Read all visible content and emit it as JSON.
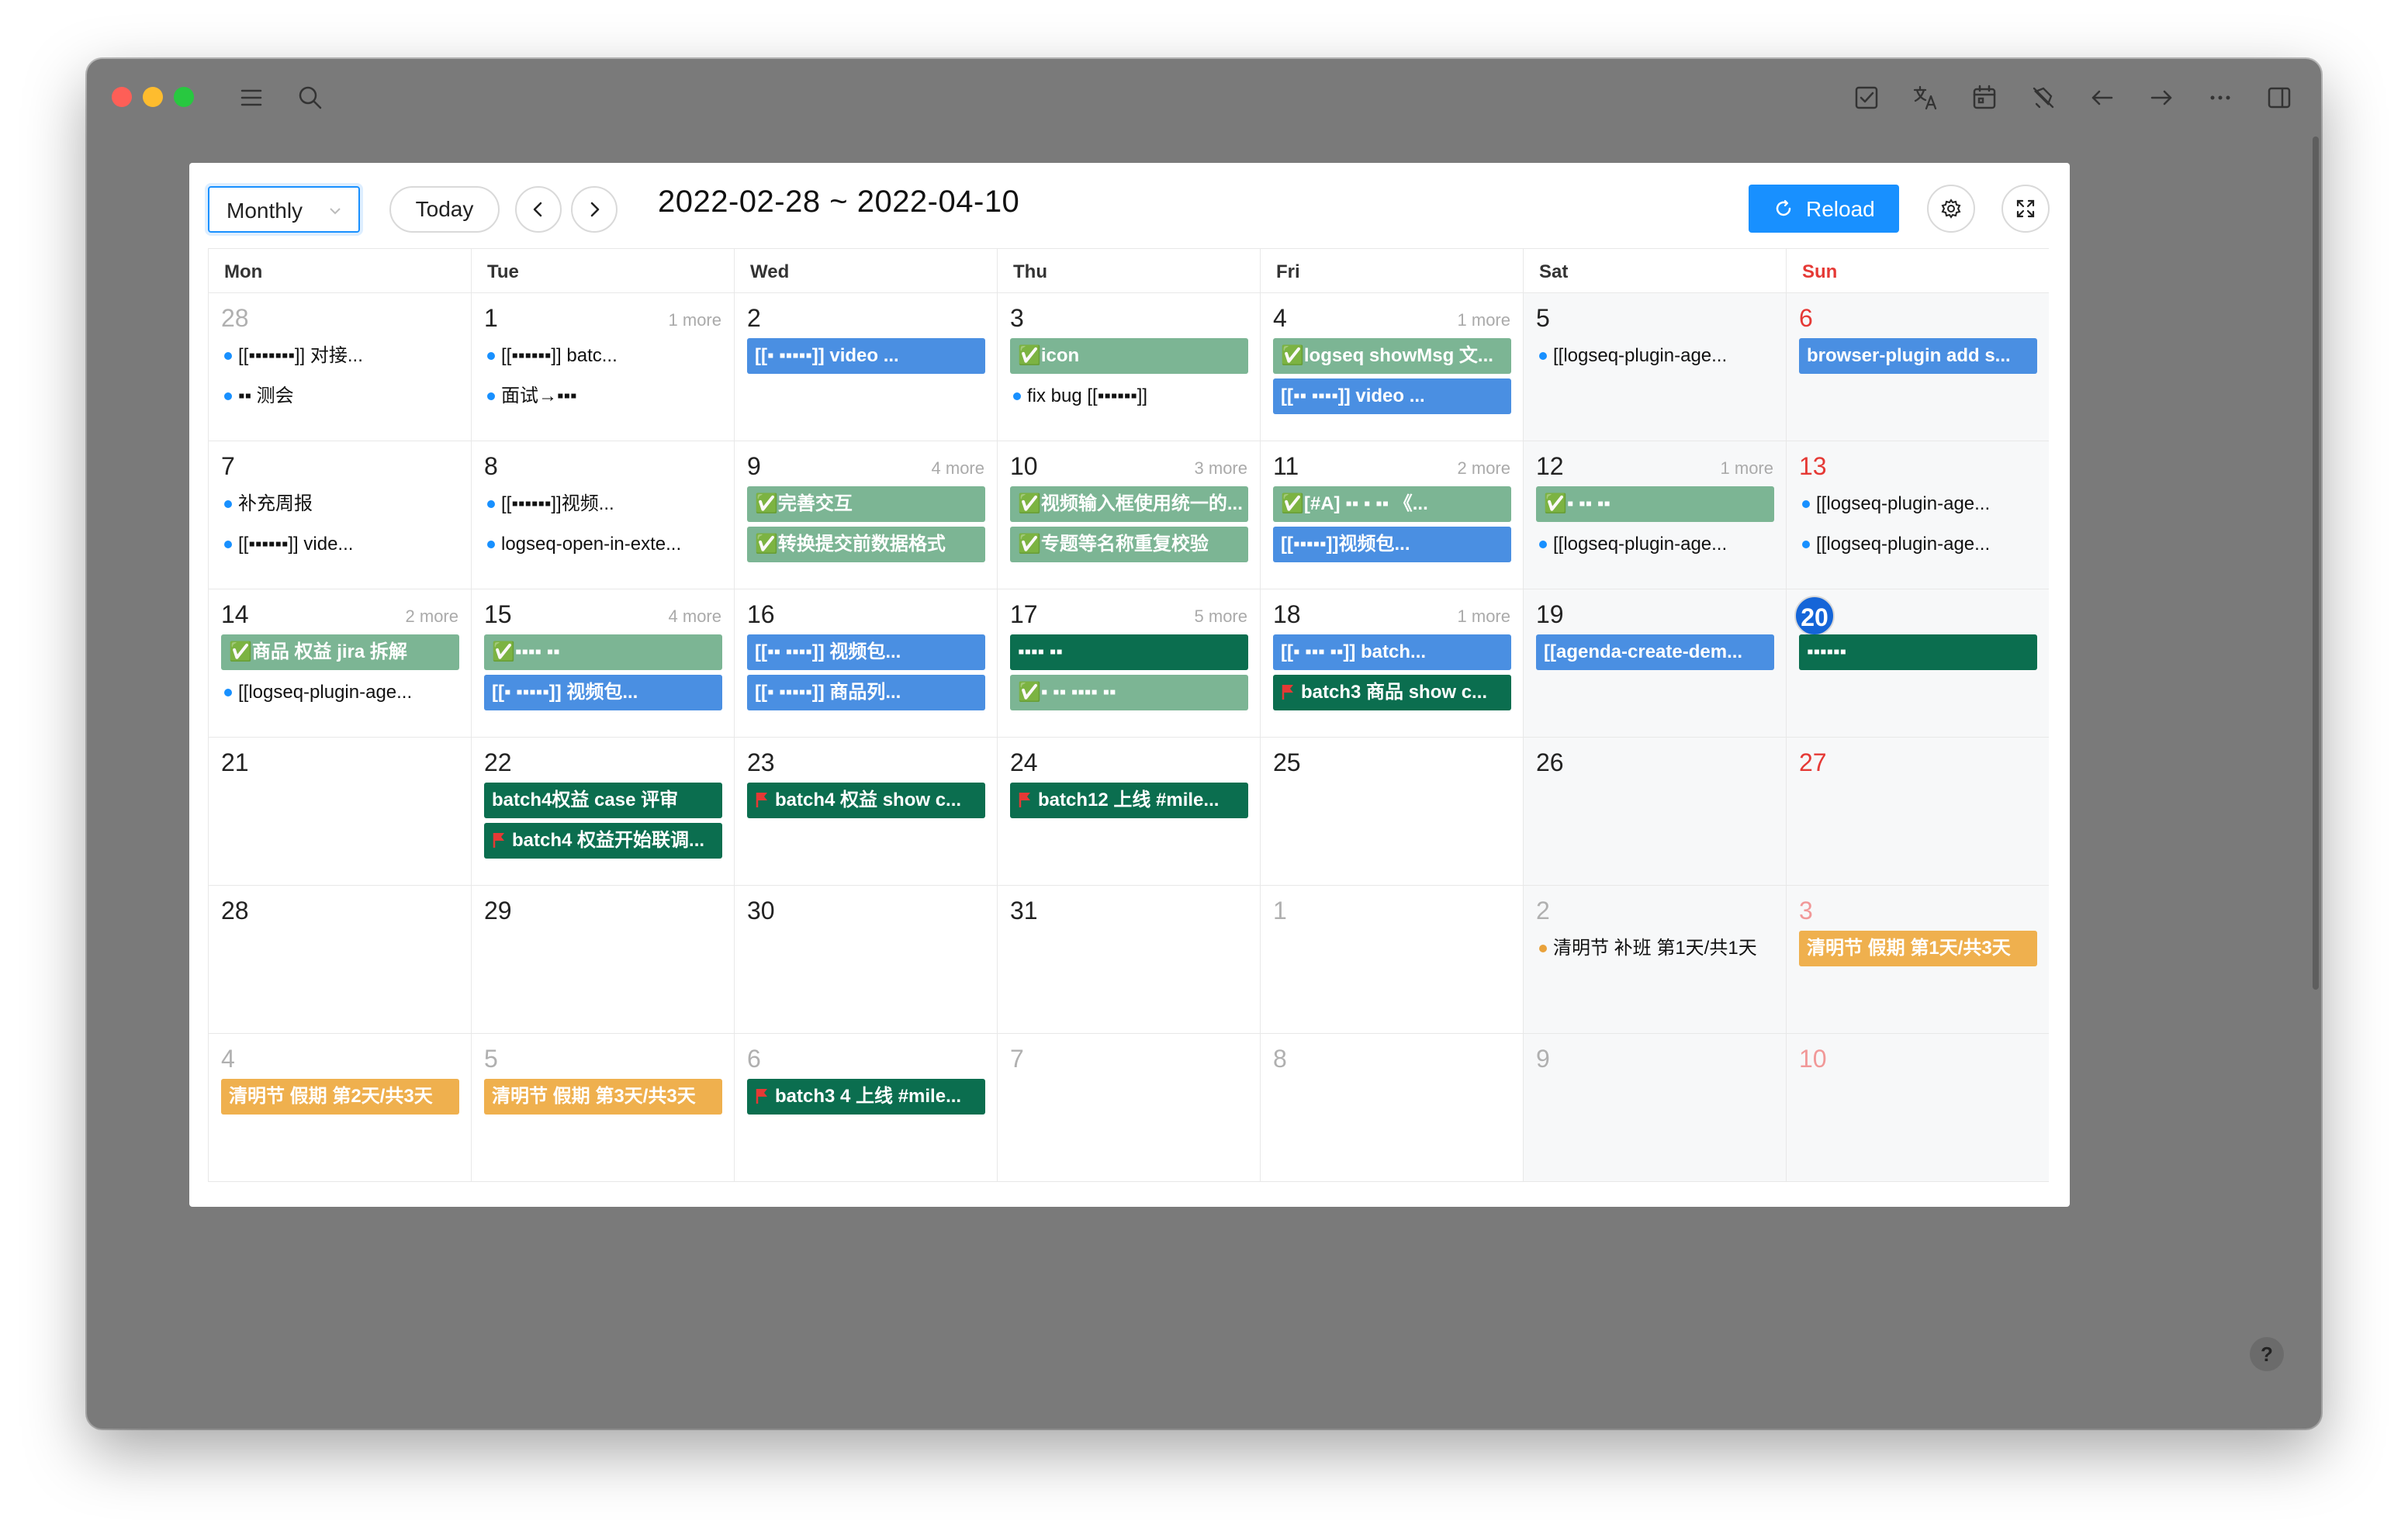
{
  "app": {
    "help_label": "?"
  },
  "toolbar": {
    "view": "Monthly",
    "today": "Today",
    "range": "2022-02-28 ~ 2022-04-10",
    "reload": "Reload"
  },
  "weekdays": [
    "Mon",
    "Tue",
    "Wed",
    "Thu",
    "Fri",
    "Sat",
    "Sun"
  ],
  "colors": {
    "blue": "#4a8fe2",
    "green": "#7cb594",
    "dark": "#0b6e4f",
    "orange": "#efb04e",
    "today": "#1565d8",
    "sunday": "#e53935",
    "accent": "#1890ff"
  },
  "weeks": [
    [
      {
        "day": "28",
        "muted": true,
        "events": [
          {
            "text": "[[▪︎▪︎▪︎▪︎▪︎▪︎▪︎]] 对接...",
            "style": "dot"
          },
          {
            "text": "▪︎▪︎ 测会",
            "style": "dot"
          }
        ]
      },
      {
        "day": "1",
        "more": "1 more",
        "events": [
          {
            "text": "[[▪︎▪︎▪︎▪︎▪︎▪︎]] batc...",
            "style": "dot"
          },
          {
            "text": "面试→▪︎▪︎▪︎",
            "style": "dot"
          }
        ]
      },
      {
        "day": "2",
        "events": [
          {
            "text": "[[▪︎ ▪︎▪︎▪︎▪︎▪︎]] video ...",
            "style": "blue"
          }
        ]
      },
      {
        "day": "3",
        "events": [
          {
            "text": "✅icon",
            "style": "green"
          },
          {
            "text": "fix bug [[▪︎▪︎▪︎▪︎▪︎▪︎]]",
            "style": "dot"
          }
        ]
      },
      {
        "day": "4",
        "more": "1 more",
        "events": [
          {
            "text": "✅logseq showMsg 文...",
            "style": "green"
          },
          {
            "text": "[[▪︎▪︎ ▪︎▪︎▪︎▪︎]] video ...",
            "style": "blue"
          }
        ]
      },
      {
        "day": "5",
        "events": [
          {
            "text": "[[logseq-plugin-age...",
            "style": "dot"
          }
        ]
      },
      {
        "day": "6",
        "sun": true,
        "events": [
          {
            "text": "browser-plugin add s...",
            "style": "blue"
          }
        ]
      }
    ],
    [
      {
        "day": "7",
        "events": [
          {
            "text": "补充周报",
            "style": "dot"
          },
          {
            "text": "[[▪︎▪︎▪︎▪︎▪︎▪︎]] vide...",
            "style": "dot"
          }
        ]
      },
      {
        "day": "8",
        "events": [
          {
            "text": "[[▪︎▪︎▪︎▪︎▪︎▪︎]]视频...",
            "style": "dot"
          },
          {
            "text": "logseq-open-in-exte...",
            "style": "dot"
          }
        ]
      },
      {
        "day": "9",
        "more": "4 more",
        "events": [
          {
            "text": "✅完善交互",
            "style": "green"
          },
          {
            "text": "✅转换提交前数据格式",
            "style": "green"
          }
        ]
      },
      {
        "day": "10",
        "more": "3 more",
        "events": [
          {
            "text": "✅视频输入框使用统一的...",
            "style": "green"
          },
          {
            "text": "✅专题等名称重复校验",
            "style": "green"
          }
        ]
      },
      {
        "day": "11",
        "more": "2 more",
        "events": [
          {
            "text": "✅[#A] ▪︎▪︎ ▪︎ ▪︎▪︎ 《...",
            "style": "green"
          },
          {
            "text": "[[▪︎▪︎▪︎▪︎▪︎]]视频包...",
            "style": "blue"
          }
        ]
      },
      {
        "day": "12",
        "more": "1 more",
        "events": [
          {
            "text": "✅▪︎ ▪︎▪︎ ▪︎▪︎",
            "style": "green"
          },
          {
            "text": "[[logseq-plugin-age...",
            "style": "dot"
          }
        ]
      },
      {
        "day": "13",
        "sun": true,
        "events": [
          {
            "text": "[[logseq-plugin-age...",
            "style": "dot"
          },
          {
            "text": "[[logseq-plugin-age...",
            "style": "dot"
          }
        ]
      }
    ],
    [
      {
        "day": "14",
        "more": "2 more",
        "events": [
          {
            "text": "✅商品 权益 jira 拆解",
            "style": "green"
          },
          {
            "text": "[[logseq-plugin-age...",
            "style": "dot"
          }
        ]
      },
      {
        "day": "15",
        "more": "4 more",
        "events": [
          {
            "text": "✅▪︎▪︎▪︎▪︎ ▪︎▪︎",
            "style": "green"
          },
          {
            "text": "[[▪︎ ▪︎▪︎▪︎▪︎▪︎]] 视频包...",
            "style": "blue"
          }
        ]
      },
      {
        "day": "16",
        "events": [
          {
            "text": "[[▪︎▪︎ ▪︎▪︎▪︎▪︎]] 视频包...",
            "style": "blue"
          },
          {
            "text": "[[▪︎ ▪︎▪︎▪︎▪︎▪︎]] 商品列...",
            "style": "blue"
          }
        ]
      },
      {
        "day": "17",
        "more": "5 more",
        "events": [
          {
            "text": "▪︎▪︎▪︎▪︎ ▪︎▪︎",
            "style": "dark"
          },
          {
            "text": "✅▪︎ ▪︎▪︎ ▪︎▪︎▪︎▪︎ ▪︎▪︎",
            "style": "green"
          }
        ]
      },
      {
        "day": "18",
        "more": "1 more",
        "events": [
          {
            "text": "[[▪︎ ▪︎▪︎▪︎ ▪︎▪︎]] batch...",
            "style": "blue"
          },
          {
            "text": "batch3 商品 show c...",
            "style": "dark",
            "flag": true
          }
        ]
      },
      {
        "day": "19",
        "events": [
          {
            "text": "[[agenda-create-dem...",
            "style": "blue"
          }
        ]
      },
      {
        "day": "20",
        "today": true,
        "events": [
          {
            "text": "▪︎▪︎▪︎▪︎▪︎▪︎",
            "style": "dark"
          }
        ]
      }
    ],
    [
      {
        "day": "21",
        "events": []
      },
      {
        "day": "22",
        "events": [
          {
            "text": "batch4权益 case 评审",
            "style": "dark"
          },
          {
            "text": "batch4 权益开始联调...",
            "style": "dark",
            "flag": true
          }
        ]
      },
      {
        "day": "23",
        "events": [
          {
            "text": "batch4 权益 show c...",
            "style": "dark",
            "flag": true
          }
        ]
      },
      {
        "day": "24",
        "events": [
          {
            "text": "batch12 上线 #mile...",
            "style": "dark",
            "flag": true
          }
        ]
      },
      {
        "day": "25",
        "events": []
      },
      {
        "day": "26",
        "events": []
      },
      {
        "day": "27",
        "sun": true,
        "events": []
      }
    ],
    [
      {
        "day": "28",
        "events": []
      },
      {
        "day": "29",
        "events": []
      },
      {
        "day": "30",
        "events": []
      },
      {
        "day": "31",
        "events": []
      },
      {
        "day": "1",
        "muted": true,
        "events": []
      },
      {
        "day": "2",
        "muted": true,
        "events": [
          {
            "text": "清明节 补班 第1天/共1天",
            "style": "dot-orange"
          }
        ]
      },
      {
        "day": "3",
        "muted": true,
        "sun": true,
        "events": [
          {
            "text": "清明节 假期 第1天/共3天",
            "style": "orange"
          }
        ]
      }
    ],
    [
      {
        "day": "4",
        "muted": true,
        "events": [
          {
            "text": "清明节 假期 第2天/共3天",
            "style": "orange"
          }
        ]
      },
      {
        "day": "5",
        "muted": true,
        "events": [
          {
            "text": "清明节 假期 第3天/共3天",
            "style": "orange"
          }
        ]
      },
      {
        "day": "6",
        "muted": true,
        "events": [
          {
            "text": "batch3 4 上线 #mile...",
            "style": "dark",
            "flag": true
          }
        ]
      },
      {
        "day": "7",
        "muted": true,
        "events": []
      },
      {
        "day": "8",
        "muted": true,
        "events": []
      },
      {
        "day": "9",
        "muted": true,
        "events": []
      },
      {
        "day": "10",
        "muted": true,
        "sun": true,
        "events": []
      }
    ]
  ]
}
